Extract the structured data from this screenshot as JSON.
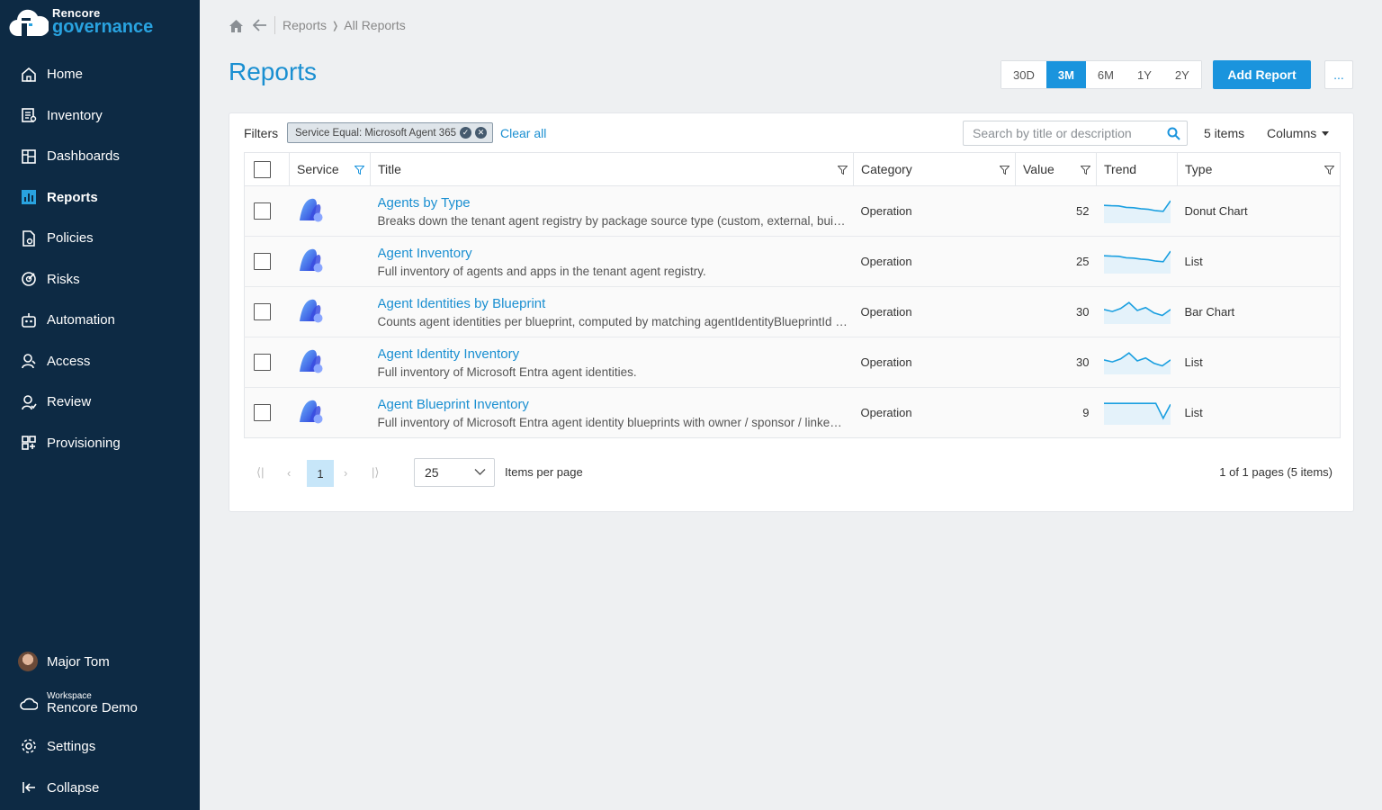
{
  "brand": {
    "line1": "Rencore",
    "line2": "governance"
  },
  "nav": [
    {
      "label": "Home",
      "icon": "home-icon"
    },
    {
      "label": "Inventory",
      "icon": "inventory-icon"
    },
    {
      "label": "Dashboards",
      "icon": "dashboards-icon"
    },
    {
      "label": "Reports",
      "icon": "reports-icon",
      "active": true
    },
    {
      "label": "Policies",
      "icon": "policies-icon"
    },
    {
      "label": "Risks",
      "icon": "risks-icon"
    },
    {
      "label": "Automation",
      "icon": "automation-icon"
    },
    {
      "label": "Access",
      "icon": "access-icon"
    },
    {
      "label": "Review",
      "icon": "review-icon"
    },
    {
      "label": "Provisioning",
      "icon": "provisioning-icon"
    }
  ],
  "user": {
    "name": "Major Tom"
  },
  "workspace": {
    "label": "Workspace",
    "name": "Rencore Demo"
  },
  "bottom": {
    "settings": "Settings",
    "collapse": "Collapse"
  },
  "breadcrumb": {
    "reports": "Reports",
    "sep": "❭",
    "current": "All Reports"
  },
  "page": {
    "title": "Reports"
  },
  "range": {
    "options": [
      "30D",
      "3M",
      "6M",
      "1Y",
      "2Y"
    ],
    "selected": "3M"
  },
  "actions": {
    "add_report": "Add Report",
    "more": "..."
  },
  "filters": {
    "label": "Filters",
    "chip": "Service Equal: Microsoft Agent 365",
    "clear_all": "Clear all"
  },
  "search": {
    "placeholder": "Search by title or description",
    "value": ""
  },
  "items_count": "5 items",
  "columns_label": "Columns",
  "table": {
    "headers": {
      "service": "Service",
      "title": "Title",
      "category": "Category",
      "value": "Value",
      "trend": "Trend",
      "type": "Type"
    },
    "rows": [
      {
        "title": "Agents by Type",
        "description": "Breaks down the tenant agent registry by package source type (custom, external, builtin).",
        "category": "Operation",
        "value": "52",
        "type": "Donut Chart",
        "trend": [
          0.72,
          0.7,
          0.69,
          0.62,
          0.6,
          0.55,
          0.52,
          0.45,
          0.42,
          0.95
        ]
      },
      {
        "title": "Agent Inventory",
        "description": "Full inventory of agents and apps in the tenant agent registry.",
        "category": "Operation",
        "value": "25",
        "type": "List",
        "trend": [
          0.72,
          0.7,
          0.69,
          0.62,
          0.6,
          0.55,
          0.52,
          0.45,
          0.42,
          0.95
        ]
      },
      {
        "title": "Agent Identities by Blueprint",
        "description": "Counts agent identities per blueprint, computed by matching agentIdentityBlueprintId on each agent identity.",
        "category": "Operation",
        "value": "30",
        "type": "Bar Chart",
        "trend": [
          0.55,
          0.45,
          0.6,
          0.9,
          0.5,
          0.65,
          0.38,
          0.25,
          0.55
        ]
      },
      {
        "title": "Agent Identity Inventory",
        "description": "Full inventory of Microsoft Entra agent identities.",
        "category": "Operation",
        "value": "30",
        "type": "List",
        "trend": [
          0.55,
          0.45,
          0.6,
          0.9,
          0.5,
          0.65,
          0.38,
          0.25,
          0.55
        ]
      },
      {
        "title": "Agent Blueprint Inventory",
        "description": "Full inventory of Microsoft Entra agent identity blueprints with owner / sponsor / linked identities.",
        "category": "Operation",
        "value": "9",
        "type": "List",
        "trend": [
          0.9,
          0.9,
          0.9,
          0.9,
          0.9,
          0.9,
          0.9,
          0.9,
          0.15,
          0.85
        ]
      }
    ]
  },
  "pagination": {
    "current_page": "1",
    "items_per_page": "25",
    "items_per_page_label": "Items per page",
    "info": "1 of 1 pages (5 items)"
  },
  "colors": {
    "sidebar": "#0d2a44",
    "accent": "#1a94dd",
    "trend_line": "#1a9fe0"
  }
}
